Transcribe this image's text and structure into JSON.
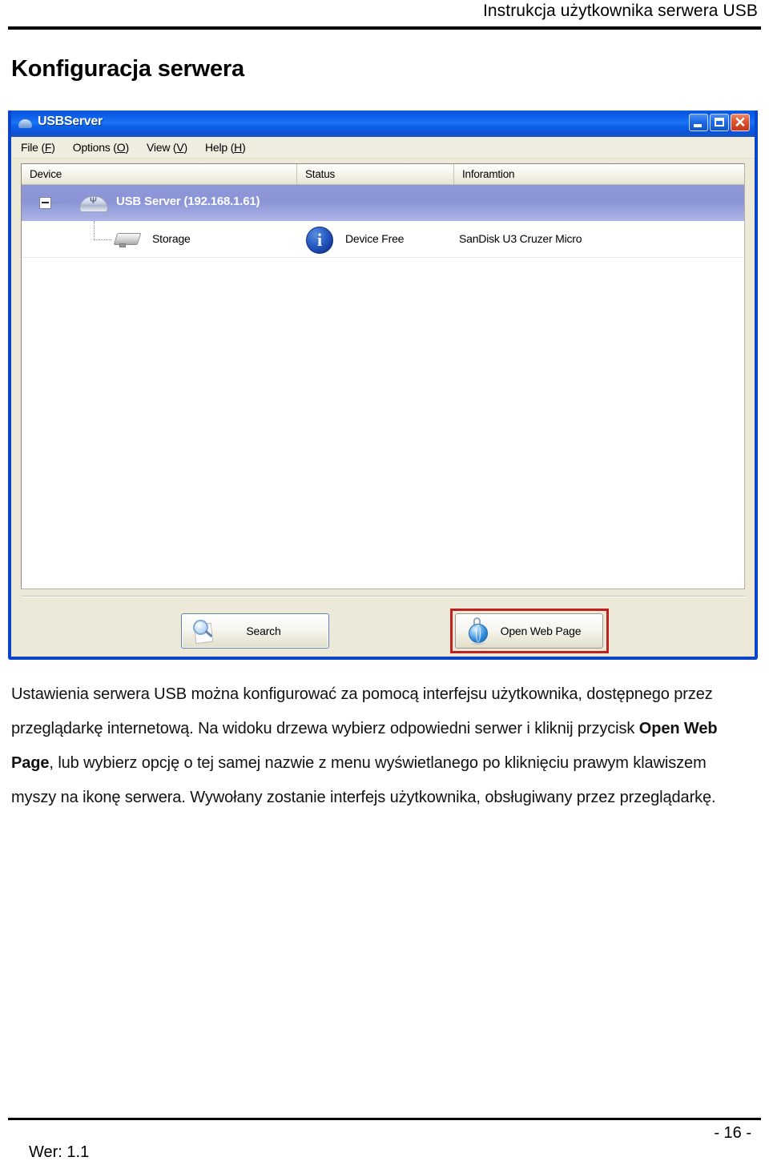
{
  "document": {
    "running_header": "Instrukcja użytkownika serwera USB",
    "heading": "Konfiguracja serwera",
    "footer": {
      "version": "Wer: 1.1",
      "page_number": "- 16 -"
    },
    "body_paragraph": {
      "part1": "Ustawienia serwera USB można konfigurować za pomocą interfejsu użytkownika, dostępnego przez przeglądarkę internetową. Na widoku drzewa wybierz odpowiedni serwer i kliknij przycisk ",
      "bold_term": "Open Web Page",
      "part2": ", lub wybierz opcję o tej samej nazwie z menu wyświetlanego po kliknięciu prawym klawiszem myszy na ikonę serwera. Wywołany zostanie interfejs użytkownika, obsługiwany przez przeglądarkę."
    }
  },
  "app_window": {
    "title": "USBServer",
    "title_icon": "usb-dome-icon",
    "window_controls": {
      "minimize": "minimize-icon",
      "maximize": "maximize-icon",
      "close": "close-icon"
    },
    "menu": [
      {
        "label_main": "File",
        "label_accel": "F"
      },
      {
        "label_main": "Options",
        "label_accel": "O"
      },
      {
        "label_main": "View",
        "label_accel": "V"
      },
      {
        "label_main": "Help",
        "label_accel": "H"
      }
    ],
    "listview": {
      "columns": [
        "Device",
        "Status",
        "Inforamtion"
      ],
      "rows": [
        {
          "device": "USB Server  (192.168.1.61)",
          "status": "",
          "information": "",
          "selected": true,
          "icon": "usb-server-icon",
          "expander": "collapse-minus-icon"
        },
        {
          "device": "Storage",
          "status": "Device Free",
          "information": "SanDisk U3 Cruzer Micro",
          "selected": false,
          "icon": "storage-device-icon",
          "status_icon": "info-circle-icon"
        }
      ]
    },
    "buttons": {
      "search": "Search",
      "open_web_page": "Open Web Page"
    },
    "colors": {
      "titlebar_blue": "#1a74f4",
      "frame_blue": "#0a44c8",
      "selection_periwinkle": "#8f99d9",
      "chrome_beige": "#ece9d8",
      "highlight_red": "#c02020"
    }
  }
}
